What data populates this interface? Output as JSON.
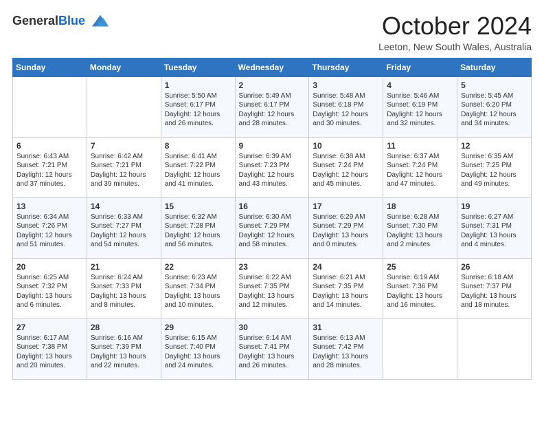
{
  "header": {
    "logo_general": "General",
    "logo_blue": "Blue",
    "month": "October 2024",
    "location": "Leeton, New South Wales, Australia"
  },
  "weekdays": [
    "Sunday",
    "Monday",
    "Tuesday",
    "Wednesday",
    "Thursday",
    "Friday",
    "Saturday"
  ],
  "rows": [
    [
      {
        "day": "",
        "info": ""
      },
      {
        "day": "",
        "info": ""
      },
      {
        "day": "1",
        "info": "Sunrise: 5:50 AM\nSunset: 6:17 PM\nDaylight: 12 hours and 26 minutes."
      },
      {
        "day": "2",
        "info": "Sunrise: 5:49 AM\nSunset: 6:17 PM\nDaylight: 12 hours and 28 minutes."
      },
      {
        "day": "3",
        "info": "Sunrise: 5:48 AM\nSunset: 6:18 PM\nDaylight: 12 hours and 30 minutes."
      },
      {
        "day": "4",
        "info": "Sunrise: 5:46 AM\nSunset: 6:19 PM\nDaylight: 12 hours and 32 minutes."
      },
      {
        "day": "5",
        "info": "Sunrise: 5:45 AM\nSunset: 6:20 PM\nDaylight: 12 hours and 34 minutes."
      }
    ],
    [
      {
        "day": "6",
        "info": "Sunrise: 6:43 AM\nSunset: 7:21 PM\nDaylight: 12 hours and 37 minutes."
      },
      {
        "day": "7",
        "info": "Sunrise: 6:42 AM\nSunset: 7:21 PM\nDaylight: 12 hours and 39 minutes."
      },
      {
        "day": "8",
        "info": "Sunrise: 6:41 AM\nSunset: 7:22 PM\nDaylight: 12 hours and 41 minutes."
      },
      {
        "day": "9",
        "info": "Sunrise: 6:39 AM\nSunset: 7:23 PM\nDaylight: 12 hours and 43 minutes."
      },
      {
        "day": "10",
        "info": "Sunrise: 6:38 AM\nSunset: 7:24 PM\nDaylight: 12 hours and 45 minutes."
      },
      {
        "day": "11",
        "info": "Sunrise: 6:37 AM\nSunset: 7:24 PM\nDaylight: 12 hours and 47 minutes."
      },
      {
        "day": "12",
        "info": "Sunrise: 6:35 AM\nSunset: 7:25 PM\nDaylight: 12 hours and 49 minutes."
      }
    ],
    [
      {
        "day": "13",
        "info": "Sunrise: 6:34 AM\nSunset: 7:26 PM\nDaylight: 12 hours and 51 minutes."
      },
      {
        "day": "14",
        "info": "Sunrise: 6:33 AM\nSunset: 7:27 PM\nDaylight: 12 hours and 54 minutes."
      },
      {
        "day": "15",
        "info": "Sunrise: 6:32 AM\nSunset: 7:28 PM\nDaylight: 12 hours and 56 minutes."
      },
      {
        "day": "16",
        "info": "Sunrise: 6:30 AM\nSunset: 7:29 PM\nDaylight: 12 hours and 58 minutes."
      },
      {
        "day": "17",
        "info": "Sunrise: 6:29 AM\nSunset: 7:29 PM\nDaylight: 13 hours and 0 minutes."
      },
      {
        "day": "18",
        "info": "Sunrise: 6:28 AM\nSunset: 7:30 PM\nDaylight: 13 hours and 2 minutes."
      },
      {
        "day": "19",
        "info": "Sunrise: 6:27 AM\nSunset: 7:31 PM\nDaylight: 13 hours and 4 minutes."
      }
    ],
    [
      {
        "day": "20",
        "info": "Sunrise: 6:25 AM\nSunset: 7:32 PM\nDaylight: 13 hours and 6 minutes."
      },
      {
        "day": "21",
        "info": "Sunrise: 6:24 AM\nSunset: 7:33 PM\nDaylight: 13 hours and 8 minutes."
      },
      {
        "day": "22",
        "info": "Sunrise: 6:23 AM\nSunset: 7:34 PM\nDaylight: 13 hours and 10 minutes."
      },
      {
        "day": "23",
        "info": "Sunrise: 6:22 AM\nSunset: 7:35 PM\nDaylight: 13 hours and 12 minutes."
      },
      {
        "day": "24",
        "info": "Sunrise: 6:21 AM\nSunset: 7:35 PM\nDaylight: 13 hours and 14 minutes."
      },
      {
        "day": "25",
        "info": "Sunrise: 6:19 AM\nSunset: 7:36 PM\nDaylight: 13 hours and 16 minutes."
      },
      {
        "day": "26",
        "info": "Sunrise: 6:18 AM\nSunset: 7:37 PM\nDaylight: 13 hours and 18 minutes."
      }
    ],
    [
      {
        "day": "27",
        "info": "Sunrise: 6:17 AM\nSunset: 7:38 PM\nDaylight: 13 hours and 20 minutes."
      },
      {
        "day": "28",
        "info": "Sunrise: 6:16 AM\nSunset: 7:39 PM\nDaylight: 13 hours and 22 minutes."
      },
      {
        "day": "29",
        "info": "Sunrise: 6:15 AM\nSunset: 7:40 PM\nDaylight: 13 hours and 24 minutes."
      },
      {
        "day": "30",
        "info": "Sunrise: 6:14 AM\nSunset: 7:41 PM\nDaylight: 13 hours and 26 minutes."
      },
      {
        "day": "31",
        "info": "Sunrise: 6:13 AM\nSunset: 7:42 PM\nDaylight: 13 hours and 28 minutes."
      },
      {
        "day": "",
        "info": ""
      },
      {
        "day": "",
        "info": ""
      }
    ]
  ]
}
